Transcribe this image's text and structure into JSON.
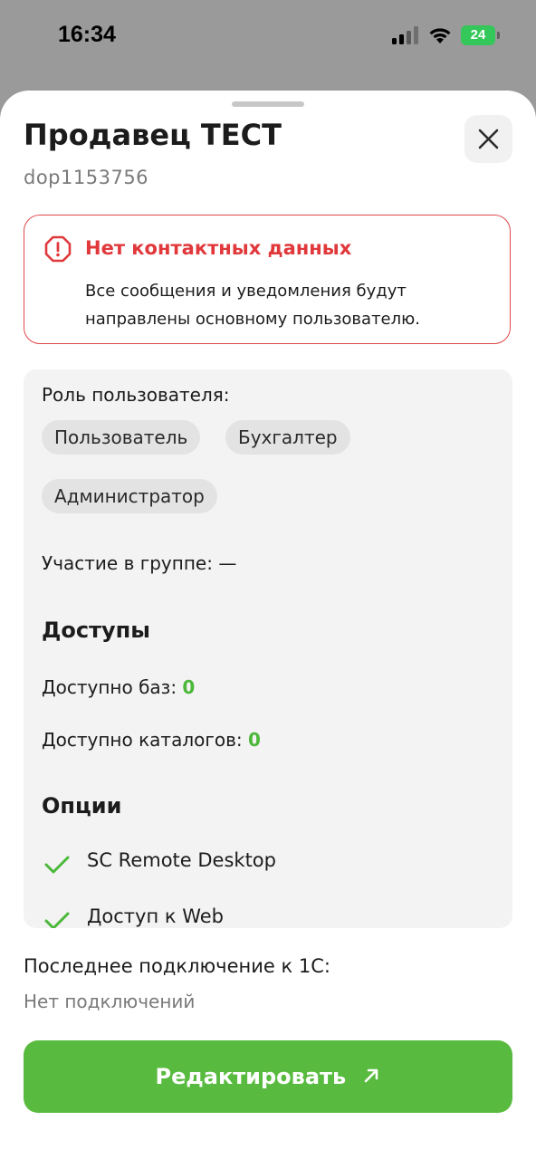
{
  "status_bar": {
    "time": "16:34",
    "battery": "24"
  },
  "header": {
    "title": "Продавец ТЕСТ",
    "subtitle": "dop1153756"
  },
  "alert": {
    "title": "Нет контактных данных",
    "text": "Все сообщения и уведомления будут направлены основному пользователю."
  },
  "info": {
    "role_label": "Роль пользователя:",
    "roles": [
      "Пользователь",
      "Бухгалтер",
      "Администратор"
    ],
    "group_label": "Участие в группе:",
    "group_value": "—",
    "access_title": "Доступы",
    "bases_label": "Доступно баз:",
    "bases_value": "0",
    "catalogs_label": "Доступно каталогов:",
    "catalogs_value": "0",
    "options_title": "Опции",
    "options": [
      "SC Remote Desktop",
      "Доступ к Web"
    ]
  },
  "last_connection": {
    "label": "Последнее подключение к 1С:",
    "value": "Нет подключений"
  },
  "edit_button": {
    "label": "Редактировать"
  },
  "colors": {
    "accent_green": "#58bb3f",
    "error_red": "#e0383b",
    "value_green": "#4cb83a"
  }
}
